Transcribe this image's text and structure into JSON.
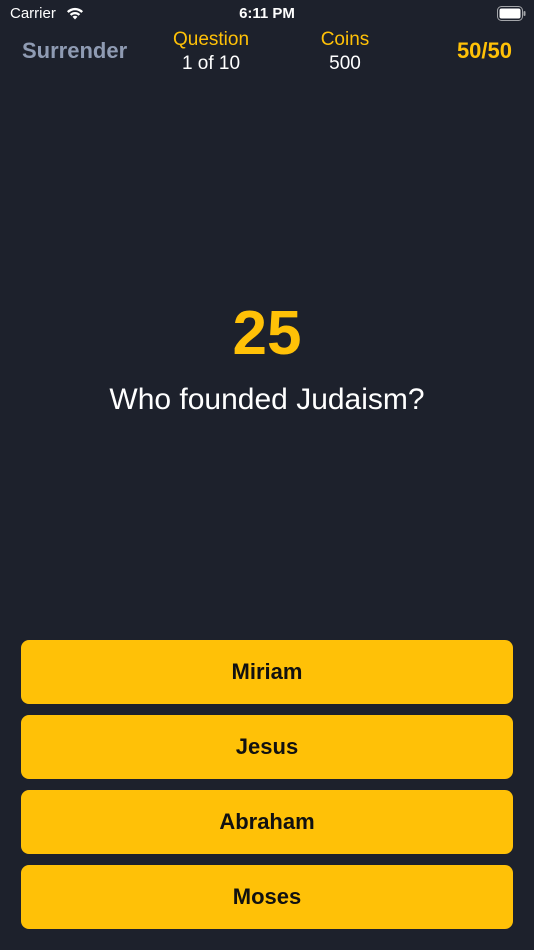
{
  "status_bar": {
    "carrier": "Carrier",
    "time": "6:11 PM",
    "wifi_icon": "wifi-icon",
    "battery_icon": "battery-icon"
  },
  "header": {
    "surrender_label": "Surrender",
    "question_label": "Question",
    "question_value": "1 of 10",
    "coins_label": "Coins",
    "coins_value": "500",
    "lifeline_label": "50/50"
  },
  "main": {
    "timer": "25",
    "question": "Who founded Judaism?"
  },
  "answers": [
    {
      "label": "Miriam"
    },
    {
      "label": "Jesus"
    },
    {
      "label": "Abraham"
    },
    {
      "label": "Moses"
    }
  ],
  "colors": {
    "background": "#1d212c",
    "accent": "#ffc107",
    "muted": "#8f9bb3"
  }
}
